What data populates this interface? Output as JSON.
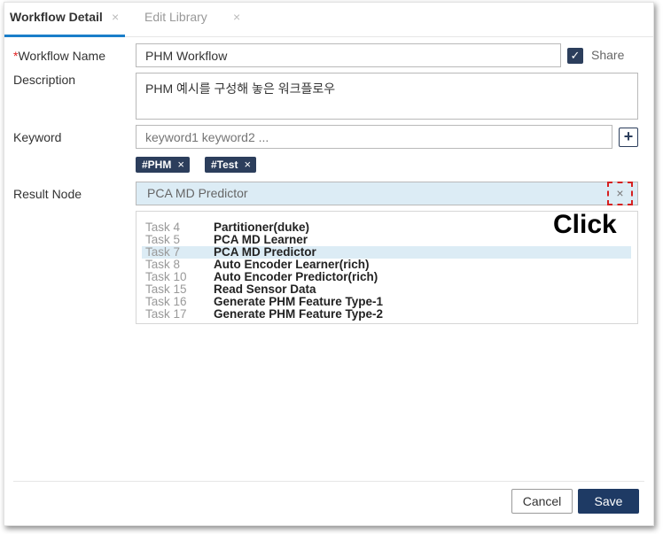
{
  "tabs": [
    {
      "label": "Workflow Detail",
      "close": "×"
    },
    {
      "label": "Edit Library",
      "close": "×"
    }
  ],
  "form": {
    "required_mark": "*",
    "workflow_name_label": "Workflow Name",
    "workflow_name_value": "PHM Workflow",
    "share_checked_icon": "✓",
    "share_label": "Share",
    "description_label": "Description",
    "description_value": "PHM 예시를 구성해 놓은 워크플로우",
    "keyword_label": "Keyword",
    "keyword_placeholder": "keyword1 keyword2 ...",
    "add_keyword_icon": "+",
    "tags": [
      {
        "label": "#PHM",
        "remove": "×"
      },
      {
        "label": "#Test",
        "remove": "×"
      }
    ],
    "result_node_label": "Result Node",
    "result_node_value": "PCA MD Predictor",
    "clear_icon": "×"
  },
  "annotation": {
    "click_label": "Click"
  },
  "dropdown": {
    "selected_index": 2,
    "items": [
      {
        "task": "Task 4",
        "name": "Partitioner(duke)"
      },
      {
        "task": "Task 5",
        "name": "PCA MD Learner"
      },
      {
        "task": "Task 7",
        "name": "PCA MD Predictor"
      },
      {
        "task": "Task 8",
        "name": "Auto Encoder Learner(rich)"
      },
      {
        "task": "Task 10",
        "name": "Auto Encoder Predictor(rich)"
      },
      {
        "task": "Task 15",
        "name": "Read Sensor Data"
      },
      {
        "task": "Task 16",
        "name": "Generate PHM Feature Type-1"
      },
      {
        "task": "Task 17",
        "name": "Generate PHM Feature Type-2"
      }
    ]
  },
  "footer": {
    "cancel_label": "Cancel",
    "save_label": "Save"
  },
  "colors": {
    "accent": "#1a7ec9",
    "navy": "#2c3e5c",
    "save": "#1e3a64",
    "selection": "#dcecf5",
    "highlight_dash": "#d62020"
  }
}
